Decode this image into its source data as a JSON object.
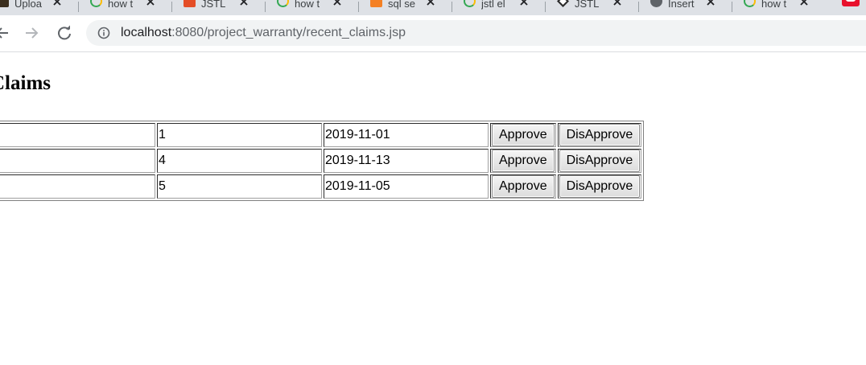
{
  "browser": {
    "tabs": [
      {
        "title": "Uploa",
        "favicon": "upload-favicon-icon"
      },
      {
        "title": "how t",
        "favicon": "google-favicon-icon"
      },
      {
        "title": "JSTL",
        "favicon": "html5-favicon-icon"
      },
      {
        "title": "how t",
        "favicon": "google-favicon-icon"
      },
      {
        "title": "sql se",
        "favicon": "stackexchange-favicon-icon"
      },
      {
        "title": "jstl el",
        "favicon": "google-favicon-icon"
      },
      {
        "title": "JSTL",
        "favicon": "diamond-favicon-icon"
      },
      {
        "title": "Insert",
        "favicon": "globe-favicon-icon"
      },
      {
        "title": "how t",
        "favicon": "google-favicon-icon"
      }
    ],
    "url_host": "localhost",
    "url_rest": ":8080/project_warranty/recent_claims.jsp"
  },
  "page": {
    "heading": "Claims",
    "approve_label": "Approve",
    "disapprove_label": "DisApprove",
    "rows": [
      {
        "c0": "",
        "c1": "1",
        "date": "2019-11-01"
      },
      {
        "c0": "",
        "c1": "4",
        "date": "2019-11-13"
      },
      {
        "c0": "",
        "c1": "5",
        "date": "2019-11-05"
      }
    ]
  }
}
